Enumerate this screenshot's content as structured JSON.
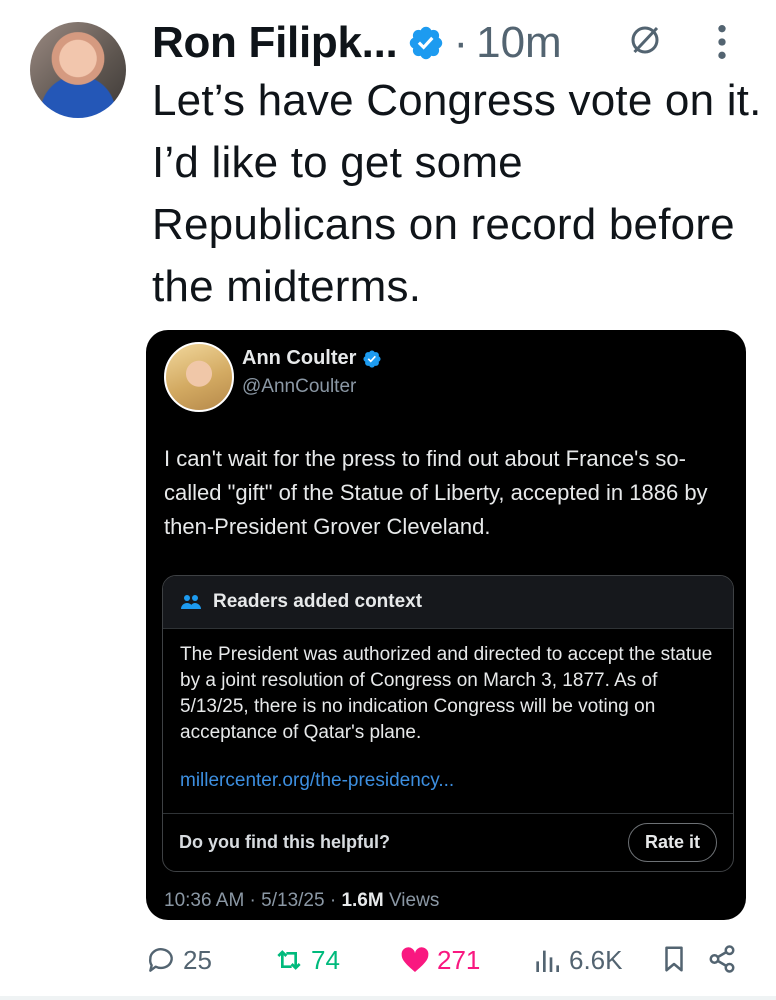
{
  "tweet": {
    "author_name": "Ron Filipk...",
    "separator": "·",
    "time": "10m",
    "text": "Let’s have Congress vote on it. I’d like to get some Republicans on record before the midterms."
  },
  "quoted": {
    "name": "Ann Coulter",
    "handle": "@AnnCoulter",
    "text": "I can't wait for the press to find out about France's so-called \"gift\" of the Statue of Liberty, accepted in 1886 by then-President Grover Cleveland.",
    "note": {
      "title": "Readers added context",
      "body": "The President was authorized and directed to accept the statue by a joint resolution of Congress on March 3, 1877. As of 5/13/25, there is no indication Congress will be voting on acceptance of Qatar's plane.",
      "link": "millercenter.org/the-presidency...",
      "question": "Do you find this helpful?",
      "rate_label": "Rate it"
    },
    "meta_time": "10:36 AM · 5/13/25 · ",
    "views_count": "1.6M",
    "views_label": " Views"
  },
  "actions": {
    "replies": "25",
    "reposts": "74",
    "likes": "271",
    "views": "6.6K"
  },
  "colors": {
    "verified": "#1d9bf0",
    "repost": "#00ba7c",
    "like": "#f91880",
    "link": "#3d8fe0"
  }
}
